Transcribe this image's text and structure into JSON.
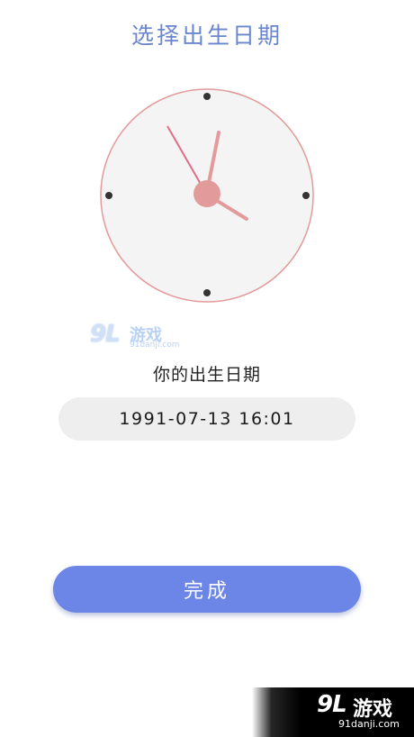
{
  "header": {
    "title": "选择出生日期"
  },
  "clock": {
    "hour": 16,
    "minute": 1,
    "accent_color": "#e39a9a",
    "face_color": "#f4f4f4"
  },
  "watermark_mid": {
    "logo": "9L",
    "text": "游戏",
    "url": "91danji.com"
  },
  "birth": {
    "label": "你的出生日期",
    "value": "1991-07-13 16:01"
  },
  "actions": {
    "done_label": "完成"
  },
  "corner_badge": {
    "logo": "9L",
    "text": "游戏",
    "url": "91danji.com"
  },
  "colors": {
    "accent": "#6b86e6",
    "title": "#6a86cf"
  }
}
